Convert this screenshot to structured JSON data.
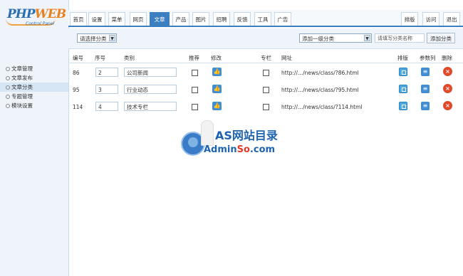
{
  "logo": {
    "brand_a": "PHP",
    "brand_b": "WEB",
    "sub": "Control Panel"
  },
  "sidebar": {
    "items": [
      {
        "label": "文章管理",
        "active": false
      },
      {
        "label": "文章发布",
        "active": false
      },
      {
        "label": "文章分类",
        "active": true
      },
      {
        "label": "专题管理",
        "active": false
      },
      {
        "label": "模块设置",
        "active": false
      }
    ]
  },
  "nav": {
    "tabs": [
      "首页",
      "设置",
      "菜单",
      "网页",
      "文章",
      "产品",
      "图片",
      "招聘",
      "反馈",
      "工具",
      "广告"
    ],
    "active": "文章",
    "right": [
      "排版",
      "访问",
      "退出"
    ]
  },
  "filter": {
    "category_select": "请选择分类",
    "add_select": "添加一级分类",
    "name_placeholder": "请填写分类名称",
    "add_button": "添加分类"
  },
  "table": {
    "headers": {
      "id": "编号",
      "order": "序号",
      "category": "类别",
      "recommend": "推荐",
      "edit": "修改",
      "column": "专栏",
      "url": "网址",
      "layout": "排版",
      "params": "参数列",
      "delete": "删除"
    },
    "rows": [
      {
        "id": "86",
        "order": "2",
        "name": "公司新闻",
        "url": "http://.../news/class/?86.html"
      },
      {
        "id": "95",
        "order": "3",
        "name": "行业动态",
        "url": "http://.../news/class/?95.html"
      },
      {
        "id": "114",
        "order": "4",
        "name": "技术专栏",
        "url": "http://.../news/class/?114.html"
      }
    ]
  },
  "watermark": {
    "line1": "AS网站目录",
    "line2_a": "Admin",
    "line2_b": "So",
    "line2_c": ".com"
  }
}
